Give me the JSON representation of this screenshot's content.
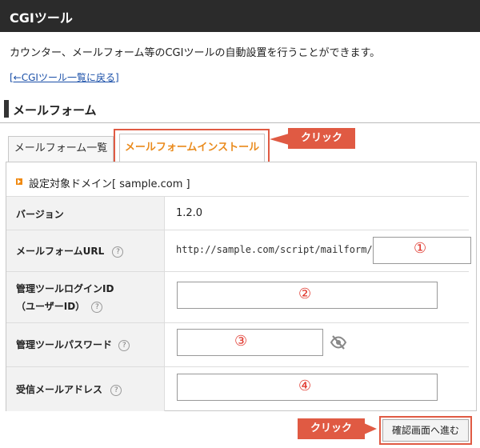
{
  "header": {
    "title": "CGIツール"
  },
  "intro": {
    "description": "カウンター、メールフォーム等のCGIツールの自動設置を行うことができます。",
    "back_link": "[←CGIツール一覧に戻る]"
  },
  "section": {
    "title": "メールフォーム"
  },
  "tabs": [
    {
      "label": "メールフォーム一覧",
      "active": false
    },
    {
      "label": "メールフォームインストール",
      "active": true
    }
  ],
  "callouts": {
    "tab": "クリック",
    "submit": "クリック"
  },
  "form": {
    "domain_label": "設定対象ドメイン[ sample.com ]",
    "rows": [
      {
        "label": "バージョン",
        "value": "1.2.0"
      },
      {
        "label": "メールフォームURL",
        "help": "?",
        "url_prefix": "http://sample.com/script/mailform/",
        "marker": "①"
      },
      {
        "label_line1": "管理ツールログインID",
        "label_line2": "（ユーザーID）",
        "help": "?",
        "marker": "②"
      },
      {
        "label": "管理ツールパスワード",
        "help": "?",
        "marker": "③"
      },
      {
        "label": "受信メールアドレス",
        "help": "?",
        "marker": "④"
      }
    ],
    "submit_label": "確認画面へ進む"
  },
  "colors": {
    "accent": "#e05a43",
    "tab_active_text": "#ea8b1d",
    "marker_number": "#e0352b",
    "title_bar": "#2b2b2b"
  }
}
